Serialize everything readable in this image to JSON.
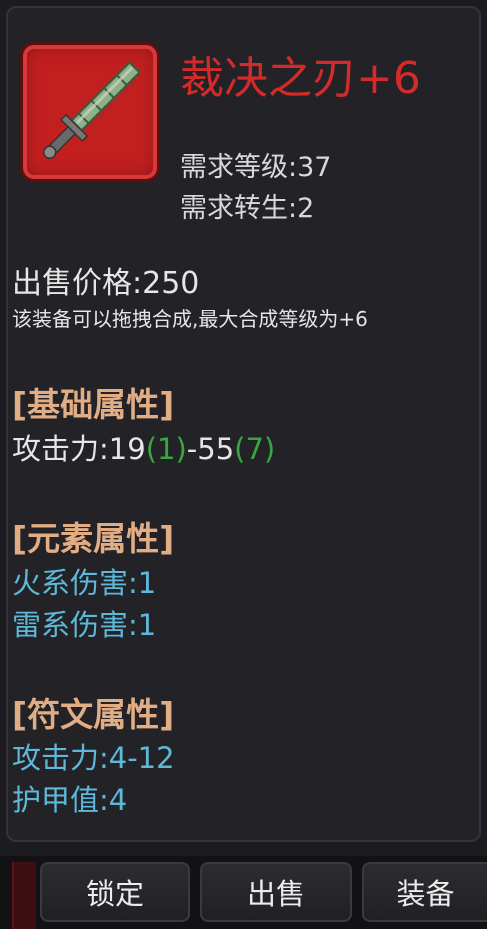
{
  "item": {
    "name": "裁决之刃+6",
    "icon": "jade-sword-icon",
    "require_level": "需求等级:37",
    "require_rebirth": "需求转生:2",
    "sell_price": "出售价格:250",
    "merge_note": "该装备可以拖拽合成,最大合成等级为+6"
  },
  "sections": {
    "basic": {
      "title": "[基础属性]",
      "attack_prefix": "攻击力:19",
      "attack_bonus_min": "(1)",
      "attack_sep": "-55",
      "attack_bonus_max": "(7)"
    },
    "element": {
      "title": "[元素属性]",
      "stats": [
        "火系伤害:1",
        "雷系伤害:1"
      ]
    },
    "rune": {
      "title": "[符文属性]",
      "stats": [
        "攻击力:4-12",
        "护甲值:4"
      ]
    }
  },
  "buttons": {
    "lock": "锁定",
    "sell": "出售",
    "equip": "装备"
  },
  "colors": {
    "item_name": "#d42a2a",
    "heading": "#e0ad85",
    "bonus_green": "#3aa640",
    "element_blue": "#5fb8d8",
    "frame_red": "#c21f1f"
  }
}
